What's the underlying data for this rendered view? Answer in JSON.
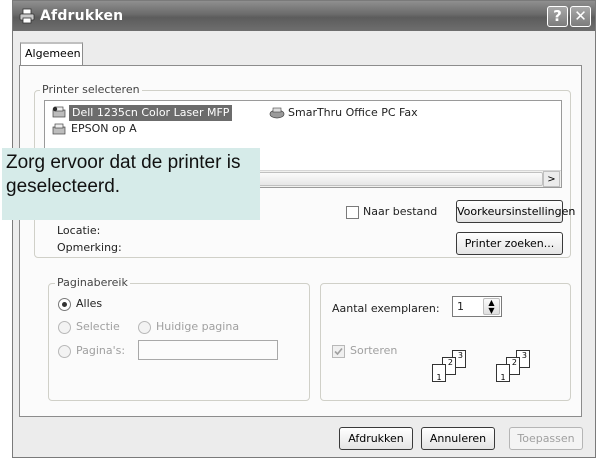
{
  "window": {
    "title": "Afdrukken",
    "help_button": "?",
    "close_button": "✕"
  },
  "tabs": [
    {
      "label": "Algemeen"
    }
  ],
  "printer_select": {
    "legend": "Printer selecteren",
    "printers": [
      {
        "name": "Dell 1235cn Color Laser MFP",
        "selected": true
      },
      {
        "name": "SmarThru Office PC Fax",
        "selected": false
      },
      {
        "name": "EPSON op A",
        "selected": false
      }
    ],
    "tooltip": "Zorg ervoor dat de printer is geselecteerd.",
    "print_to_file_label": "Naar bestand",
    "preferences_button": "Voorkeursinstellingen",
    "location_label": "Locatie:",
    "comment_label": "Opmerking:",
    "find_printer_button": "Printer zoeken..."
  },
  "page_range": {
    "legend": "Paginabereik",
    "all_label": "Alles",
    "selection_label": "Selectie",
    "current_page_label": "Huidige pagina",
    "pages_label": "Pagina's:",
    "pages_value": "",
    "selected_option": "all"
  },
  "copies": {
    "label": "Aantal exemplaren:",
    "value": "1",
    "collate_label": "Sorteren",
    "collate_checked": true,
    "collate_page_numbers": [
      "1",
      "2",
      "3",
      "1",
      "2",
      "3"
    ]
  },
  "footer": {
    "print_button": "Afdrukken",
    "cancel_button": "Annuleren",
    "apply_button": "Toepassen"
  },
  "colors": {
    "selection_bg": "#6c6c6c",
    "tooltip_bg": "#d6ebe9"
  }
}
